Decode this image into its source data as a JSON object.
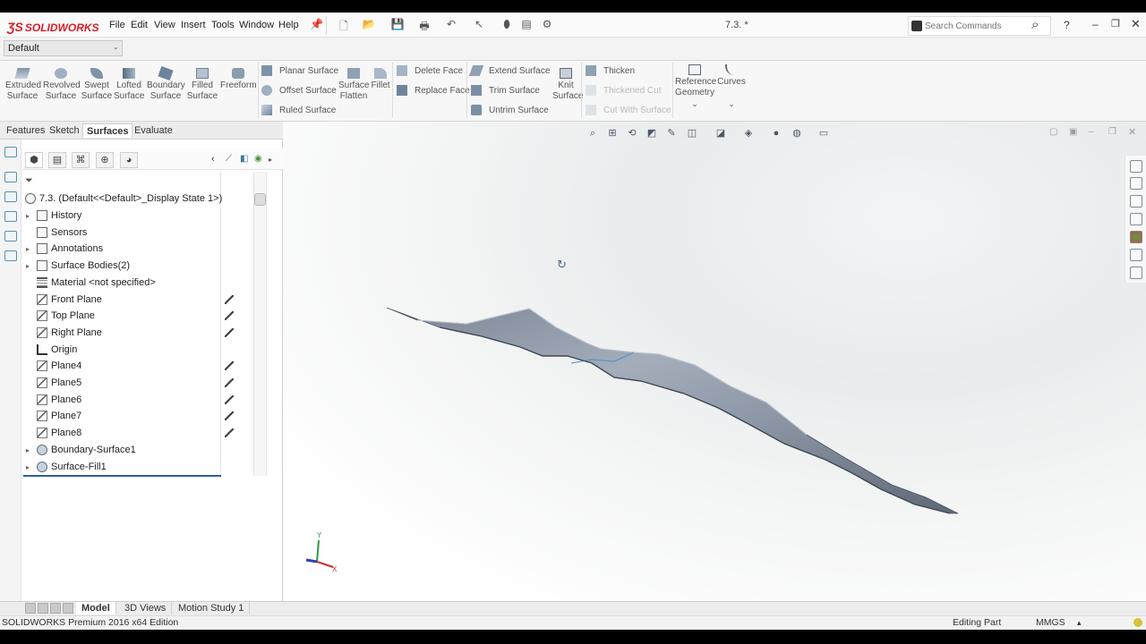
{
  "app": {
    "brand": "SOLIDWORKS",
    "document_title": "7.3. *"
  },
  "menu": [
    "File",
    "Edit",
    "View",
    "Insert",
    "Tools",
    "Window",
    "Help"
  ],
  "search": {
    "placeholder": "Search Commands"
  },
  "config": {
    "selected": "Default"
  },
  "ribbon": {
    "big_buttons": [
      {
        "id": "extruded",
        "label1": "Extruded",
        "label2": "Surface",
        "icon": "extruded-surface-icon"
      },
      {
        "id": "revolved",
        "label1": "Revolved",
        "label2": "Surface",
        "icon": "revolved-surface-icon"
      },
      {
        "id": "swept",
        "label1": "Swept",
        "label2": "Surface",
        "icon": "swept-surface-icon"
      },
      {
        "id": "lofted",
        "label1": "Lofted",
        "label2": "Surface",
        "icon": "lofted-surface-icon"
      },
      {
        "id": "boundary",
        "label1": "Boundary",
        "label2": "Surface",
        "icon": "boundary-surface-icon"
      },
      {
        "id": "filled",
        "label1": "Filled",
        "label2": "Surface",
        "icon": "filled-surface-icon"
      },
      {
        "id": "freeform",
        "label1": "Freeform",
        "label2": "",
        "icon": "freeform-icon"
      }
    ],
    "col1": [
      "Planar Surface",
      "Offset Surface",
      "Ruled Surface"
    ],
    "surface_flatten": [
      "Surface",
      "Flatten"
    ],
    "fillet": "Fillet",
    "col2": [
      "Delete Face",
      "Replace Face"
    ],
    "col3": [
      "Extend Surface",
      "Trim Surface",
      "Untrim Surface"
    ],
    "knit": [
      "Knit",
      "Surface"
    ],
    "col4": [
      {
        "label": "Thicken",
        "disabled": false
      },
      {
        "label": "Thickened Cut",
        "disabled": true
      },
      {
        "label": "Cut With Surface",
        "disabled": true
      }
    ],
    "reference_geometry": [
      "Reference",
      "Geometry"
    ],
    "curves": "Curves"
  },
  "tabs": [
    "Features",
    "Sketch",
    "Surfaces",
    "Evaluate"
  ],
  "active_tab": "Surfaces",
  "tree": {
    "root": "7.3.  (Default<<Default>_Display State 1>)",
    "items": [
      {
        "label": "History",
        "icon": "folder",
        "arrow": true,
        "hidden_mark": false
      },
      {
        "label": "Sensors",
        "icon": "folder",
        "arrow": false,
        "hidden_mark": false
      },
      {
        "label": "Annotations",
        "icon": "folder",
        "arrow": true,
        "hidden_mark": false
      },
      {
        "label": "Surface Bodies(2)",
        "icon": "folder",
        "arrow": true,
        "hidden_mark": false
      },
      {
        "label": "Material <not specified>",
        "icon": "material",
        "arrow": false,
        "hidden_mark": false
      },
      {
        "label": "Front Plane",
        "icon": "plane",
        "arrow": false,
        "hidden_mark": true
      },
      {
        "label": "Top Plane",
        "icon": "plane",
        "arrow": false,
        "hidden_mark": true
      },
      {
        "label": "Right Plane",
        "icon": "plane",
        "arrow": false,
        "hidden_mark": true
      },
      {
        "label": "Origin",
        "icon": "origin",
        "arrow": false,
        "hidden_mark": false
      },
      {
        "label": "Plane4",
        "icon": "plane",
        "arrow": false,
        "hidden_mark": true
      },
      {
        "label": "Plane5",
        "icon": "plane",
        "arrow": false,
        "hidden_mark": true
      },
      {
        "label": "Plane6",
        "icon": "plane",
        "arrow": false,
        "hidden_mark": true
      },
      {
        "label": "Plane7",
        "icon": "plane",
        "arrow": false,
        "hidden_mark": true
      },
      {
        "label": "Plane8",
        "icon": "plane",
        "arrow": false,
        "hidden_mark": true
      },
      {
        "label": "Boundary-Surface1",
        "icon": "surface",
        "arrow": true,
        "hidden_mark": false
      },
      {
        "label": "Surface-Fill1",
        "icon": "surface",
        "arrow": true,
        "hidden_mark": false
      }
    ]
  },
  "bottom_tabs": [
    "Model",
    "3D Views",
    "Motion Study 1"
  ],
  "active_bottom_tab": "Model",
  "status": {
    "edition": "SOLIDWORKS Premium 2016 x64 Edition",
    "mode": "Editing Part",
    "units": "MMGS"
  },
  "triad": {
    "y": "Y",
    "x": "X"
  },
  "colors": {
    "brand_red": "#d81e2a",
    "surface": "#9ba5b3",
    "tree_highlight": "#2f5ca5"
  }
}
